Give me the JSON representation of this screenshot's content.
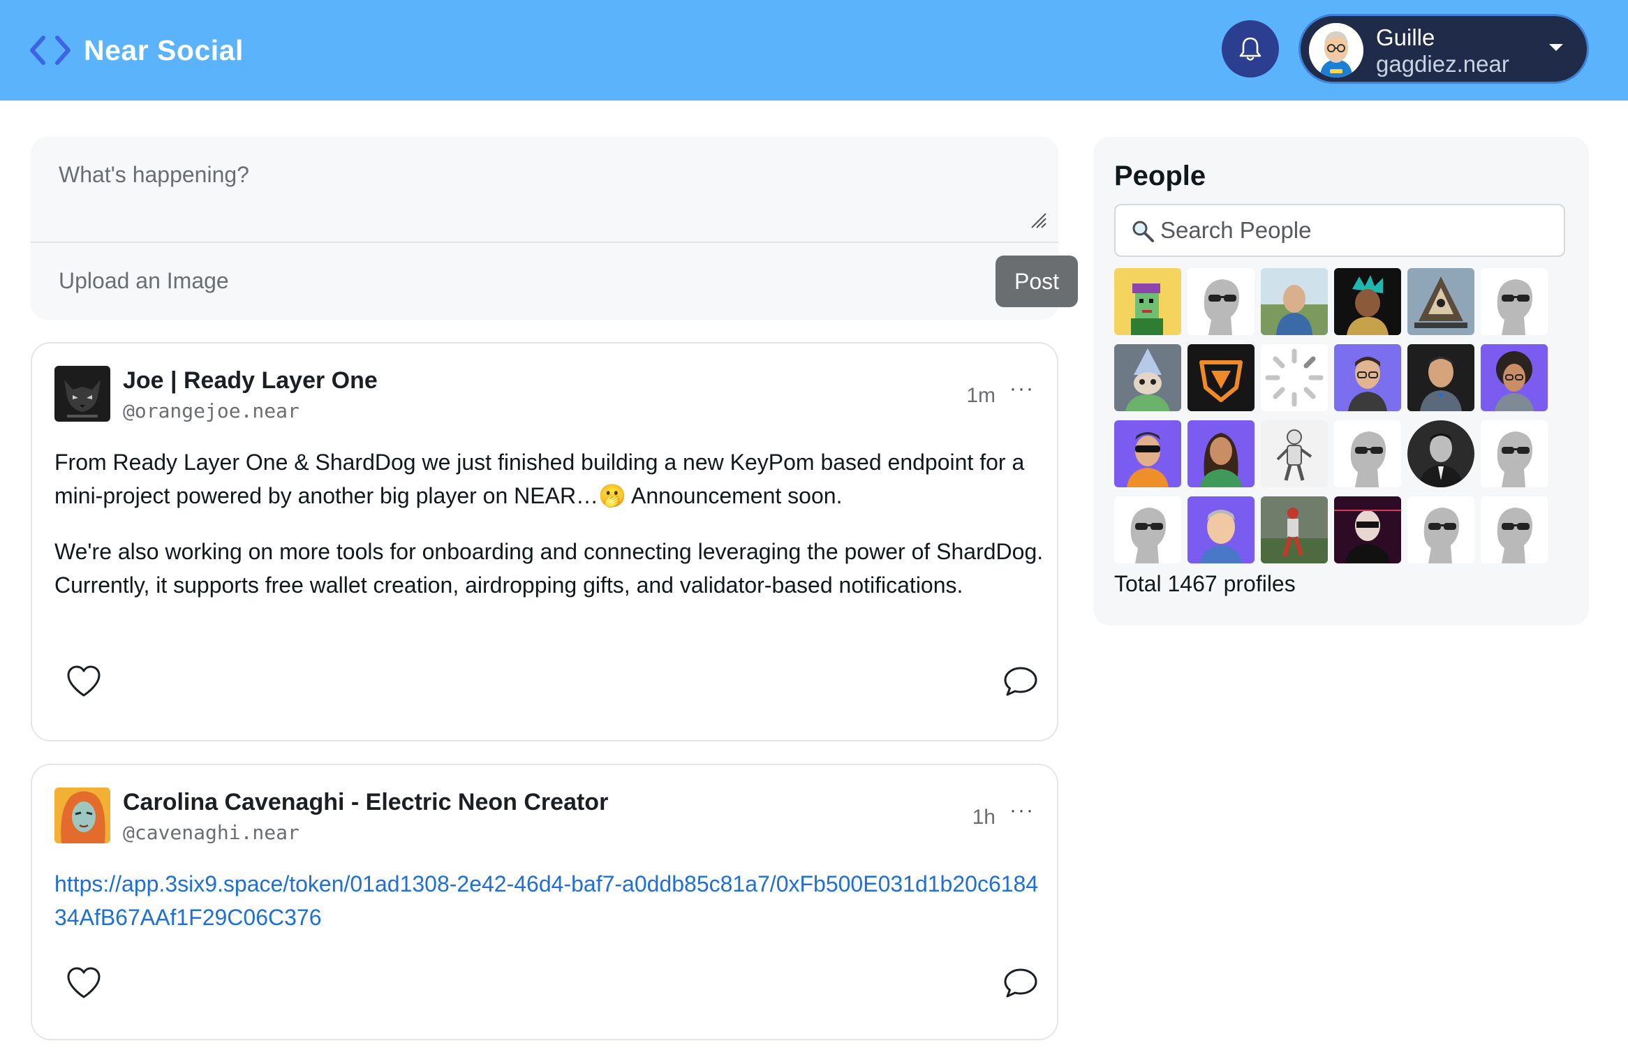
{
  "header": {
    "brand": "Near Social",
    "brand_icon": "code-brackets-icon",
    "notification_icon": "bell-icon",
    "account": {
      "name": "Guille",
      "handle": "gagdiez.near"
    }
  },
  "compose": {
    "placeholder": "What's happening?",
    "upload_label": "Upload an Image",
    "post_label": "Post"
  },
  "feed": [
    {
      "author": "Joe | Ready Layer One",
      "handle": "@orangejoe.near",
      "time": "1m",
      "more": "···",
      "paragraphs": [
        "From Ready Layer One & ShardDog we just finished building a new KeyPom based endpoint for a mini-project powered by another big player on NEAR…🫢 Announcement soon.",
        "We're also working on more tools for onboarding and connecting leveraging the power of ShardDog. Currently, it supports free wallet creation, airdropping gifts, and validator-based notifications."
      ]
    },
    {
      "author": "Carolina Cavenaghi - Electric Neon Creator",
      "handle": "@cavenaghi.near",
      "time": "1h",
      "more": "···",
      "link": "https://app.3six9.space/token/01ad1308-2e42-46d4-baf7-a0ddb85c81a7/0xFb500E031d1b20c618434AfB67AAf1F29C06C376"
    }
  ],
  "people": {
    "title": "People",
    "search_placeholder": "Search People",
    "total": "Total 1467 profiles"
  },
  "colors": {
    "header_bg": "#5bb4fb",
    "link": "#1e6fd9",
    "post_button": "#6b6e71",
    "account_pill": "#1f2b48"
  }
}
